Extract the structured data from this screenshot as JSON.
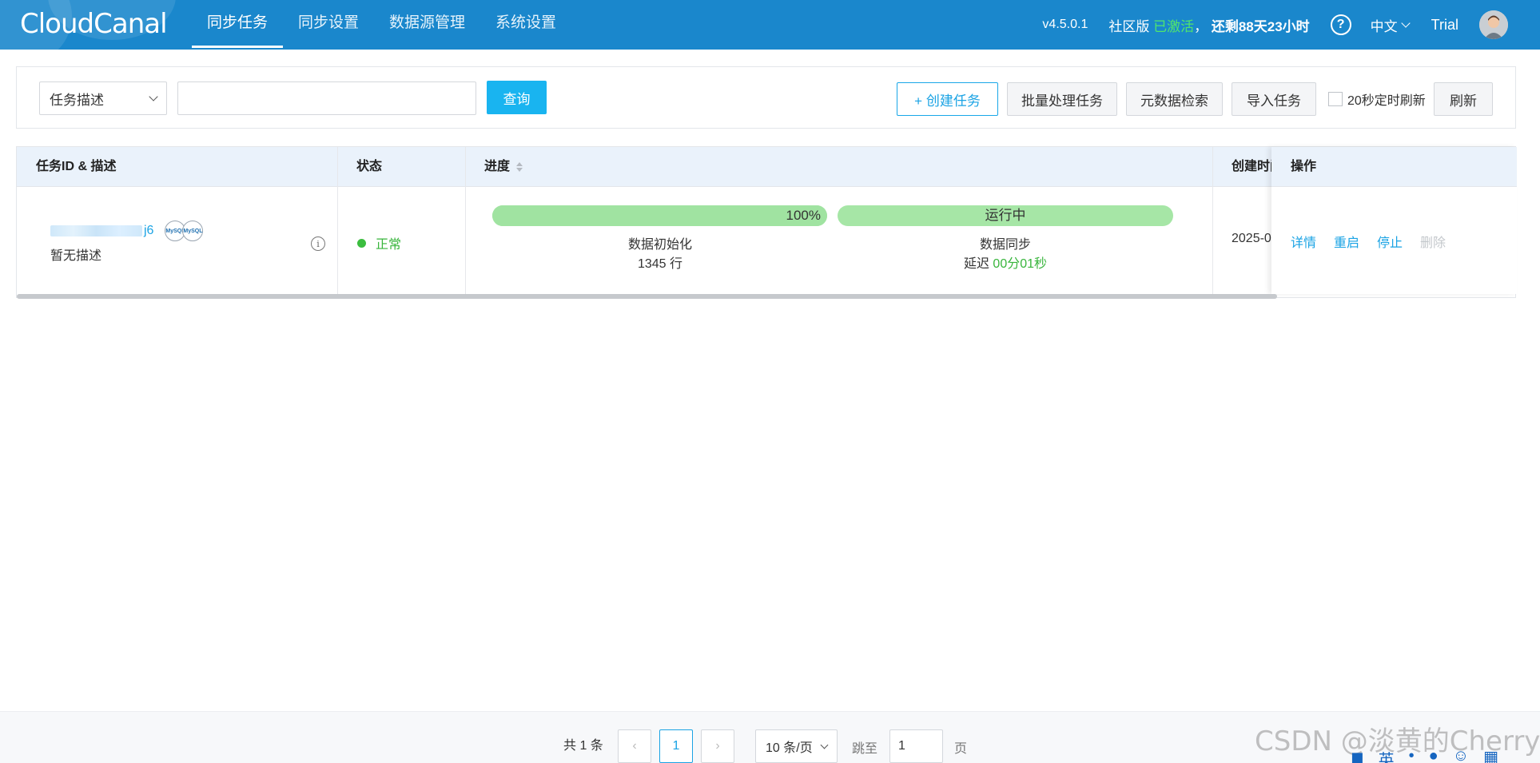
{
  "header": {
    "logo": "CloudCanal",
    "nav": [
      "同步任务",
      "同步设置",
      "数据源管理",
      "系统设置"
    ],
    "version": "v4.5.0.1",
    "edition": "社区版",
    "activated": "已激活",
    "comma": "，",
    "remaining": "还剩88天23小时",
    "help": "?",
    "language": "中文",
    "plan": "Trial"
  },
  "filter": {
    "select_value": "任务描述",
    "search_value": "",
    "query_label": "查询",
    "create_label": "+ 创建任务",
    "batch_label": "批量处理任务",
    "metadata_label": "元数据检索",
    "import_label": "导入任务",
    "auto_refresh_label": "20秒定时刷新",
    "refresh_label": "刷新"
  },
  "table": {
    "columns": [
      "任务ID & 描述",
      "状态",
      "进度",
      "创建时间",
      "操作"
    ],
    "rows": [
      {
        "id_suffix": "j6",
        "db_source": "MySQL",
        "db_target": "MySQL",
        "description": "暂无描述",
        "status": "正常",
        "status_color": "#3bbd3f",
        "init_progress": "100%",
        "init_stage": "数据初始化",
        "init_rows": "1345 行",
        "sync_state": "运行中",
        "sync_stage": "数据同步",
        "delay_label": "延迟",
        "delay_value": "00分01秒",
        "created": "2025-0",
        "actions": [
          "详情",
          "重启",
          "停止",
          "删除"
        ]
      }
    ]
  },
  "pagination": {
    "total": "共 1 条",
    "prev": "‹",
    "current_page": "1",
    "next": "›",
    "page_size": "10 条/页",
    "jump_label": "跳至",
    "jump_value": "1",
    "page_unit": "页"
  },
  "watermark": "CSDN @淡黄的Cherry",
  "colors": {
    "header_bg": "#1a87cc",
    "accent": "#1aa3e4",
    "success": "#3bbd3f",
    "progress": "#a0e3a1"
  }
}
